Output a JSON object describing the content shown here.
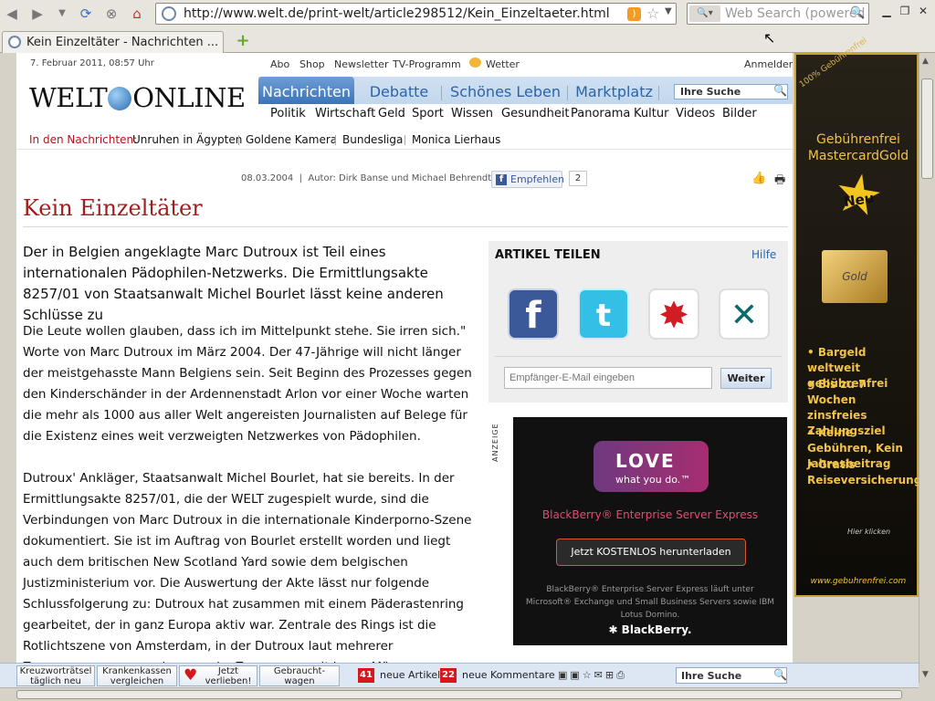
{
  "browser": {
    "url": "http://www.welt.de/print-welt/article298512/Kein_Einzeltaeter.html",
    "search_placeholder": "Web Search (powered",
    "tab_title": "Kein Einzeltäter - Nachrichten ...",
    "nav_icons": [
      "back-icon",
      "forward-icon",
      "history-dropdown-icon",
      "reload-icon",
      "stop-icon",
      "home-icon"
    ],
    "window_controls": [
      "minimize",
      "restore",
      "close"
    ]
  },
  "site": {
    "date": "7. Februar 2011, 08:57 Uhr",
    "top_links": [
      "Abo",
      "Shop",
      "Newsletter",
      "TV-Programm",
      "Wetter"
    ],
    "login": "Anmelden",
    "logo_left": "WELT",
    "logo_right": "ONLINE",
    "main_tabs": [
      "Nachrichten",
      "Debatte",
      "Schönes Leben",
      "Marktplatz"
    ],
    "search_placeholder": "Ihre Suche",
    "sub_nav": [
      "Politik",
      "Wirtschaft",
      "Geld",
      "Sport",
      "Wissen",
      "Gesundheit",
      "Panorama",
      "Kultur",
      "Videos",
      "Bilder"
    ],
    "in_the_news_label": "In den Nachrichten:",
    "in_the_news": [
      "Unruhen in Ägypten",
      "Goldene Kamera",
      "Bundesliga",
      "Monica Lierhaus"
    ]
  },
  "article": {
    "date": "08.03.2004",
    "author": "Autor: Dirk Banse und Michael Behrendt",
    "like_label": "Empfehlen",
    "like_count": "2",
    "title": "Kein Einzeltäter",
    "lead": "Der in Belgien angeklagte Marc Dutroux ist Teil eines internationalen Pädophilen-Netzwerks. Die Ermittlungsakte 8257/01 von Staatsanwalt Michel Bourlet lässt keine anderen Schlüsse zu",
    "para1": "Die Leute wollen glauben, dass ich im Mittelpunkt stehe. Sie irren sich.\" Worte von Marc Dutroux im März 2004. Der 47-Jährige will nicht länger der meistgehasste Mann Belgiens sein. Seit Beginn des Prozesses gegen den Kinderschänder in der Ardennenstadt Arlon vor einer Woche warten die mehr als 1000 aus aller Welt angereisten Journalisten auf Belege für die Existenz eines weit verzweigten Netzwerkes von Pädophilen.",
    "para2": "Dutroux' Ankläger, Staatsanwalt Michel Bourlet, hat sie bereits. In der Ermittlungsakte 8257/01, die der WELT zugespielt wurde, sind die Verbindungen von Marc Dutroux in die internationale Kinderporno-Szene dokumentiert. Sie ist im Auftrag von Bourlet erstellt worden und liegt auch dem britischen New Scotland Yard sowie dem belgischen Justizministerium vor. Die Auswertung der Akte lässt nur folgende Schlussfolgerung zu: Dutroux hat zusammen mit einem Päderastenring gearbeitet, der in ganz Europa aktiv war. Zentrale des Rings ist die Rotlichtszene von Amsterdam, in der Dutroux laut mehrerer Zeugenaussagen gesehen wurde. Zusammen mit jenen Männern,"
  },
  "share": {
    "title": "ARTIKEL TEILEN",
    "help": "Hilfe",
    "email_placeholder": "Empfänger-E-Mail eingeben",
    "submit": "Weiter"
  },
  "ad_bb": {
    "label": "ANZEIGE",
    "love": "LOVE",
    "tagline": "what you do.™",
    "product": "BlackBerry® Enterprise Server Express",
    "cta": "Jetzt KOSTENLOS herunterladen",
    "fineprint": "BlackBerry® Enterprise Server Express läuft unter Microsoft® Exchange und Small Business Servers sowie IBM Lotus Domino.",
    "brand": "✱ BlackBerry."
  },
  "ad_side": {
    "badge": "100% Gebührenfrei",
    "headline": "Gebührenfrei MastercardGold",
    "neu": "Neu",
    "card": "Gold",
    "bullets": [
      "• Bargeld weltweit gebührenfrei",
      "• Bis zu 7 Wochen zinsfreies Zahlungsziel",
      "• Keine Gebühren, Kein Jahresbeitrag",
      "• Gratis Reiseversicherung"
    ],
    "click": "Hier klicken",
    "url": "www.gebuhrenfrei.com"
  },
  "bottombar": {
    "buttons": [
      "Kreuzworträtsel täglich neu",
      "Krankenkassen vergleichen",
      "Jetzt verlieben!",
      "Gebraucht-wagen"
    ],
    "new_articles_count": "41",
    "new_articles": "neue Artikel",
    "new_comments_count": "22",
    "new_comments": "neue Kommentare",
    "search_placeholder": "Ihre Suche"
  },
  "colors": {
    "accent": "#2c64a8",
    "brand_red": "#a11e1e",
    "news_red": "#b6121b"
  }
}
